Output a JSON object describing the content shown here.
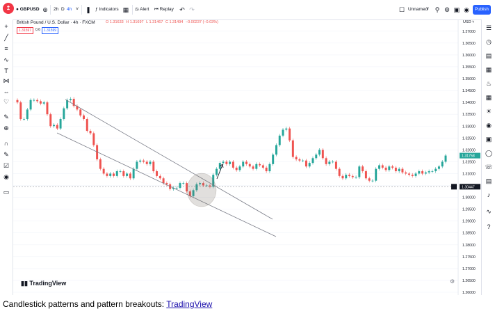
{
  "toolbar": {
    "symbol": "GBPUSD",
    "interval": "2h",
    "chart_type": "D",
    "timeframe": "4h",
    "indicators_label": "Indicators",
    "alert_label": "Alert",
    "replay_label": "Replay",
    "layout_name": "Unnamed",
    "publish_label": "Publish"
  },
  "legend": {
    "title": "British Pound / U.S. Dollar · 4h · FXCM",
    "open": "O 1.31633",
    "high": "H 1.31697",
    "low": "L 1.31467",
    "close": "C 1.31494",
    "change": "−0.00237 (−0.03%)",
    "sell_price": "1.31597",
    "spread": "0.6",
    "buy_price": "1.31599"
  },
  "price_axis": {
    "currency": "USD",
    "ticks": [
      "1.37000",
      "1.36500",
      "1.36000",
      "1.35500",
      "1.35000",
      "1.34500",
      "1.34000",
      "1.33500",
      "1.33000",
      "1.32500",
      "1.32000",
      "1.31500",
      "1.31000",
      "1.30500",
      "1.30000",
      "1.29500",
      "1.29000",
      "1.28500",
      "1.28000",
      "1.27500",
      "1.27000",
      "1.26500",
      "1.26000"
    ],
    "current_price": "1.31758",
    "crosshair_price": "1.30447"
  },
  "watermark": "TradingView",
  "caption": {
    "text": "Candlestick patterns and pattern breakouts: ",
    "link": "TradingView"
  },
  "colors": {
    "up": "#26a69a",
    "down": "#ef5350",
    "accent": "#2962ff",
    "trendline": "#787b86"
  },
  "icons": {
    "left": [
      "crosshair-icon",
      "trendline-icon",
      "fib-icon",
      "pattern-icon",
      "text-icon",
      "measure-icon",
      "forecast-icon",
      "heart-icon",
      "ruler-icon",
      "zoom-icon",
      "magnet-icon",
      "lock-drawings-icon",
      "lock-icon",
      "eye-icon",
      "trash-icon"
    ],
    "right": [
      "watchlist-icon",
      "alerts-icon",
      "news-icon",
      "data-window-icon",
      "hotlist-icon",
      "calendar-icon",
      "ideas-icon",
      "streams-icon",
      "chat-icon",
      "notifications-icon",
      "help-icon"
    ]
  },
  "chart_data": {
    "type": "candlestick",
    "series_name": "GBPUSD 4h",
    "ylim": [
      1.26,
      1.372
    ],
    "grid": true,
    "close": [
      1.34,
      1.333,
      1.333,
      1.337,
      1.341,
      1.341,
      1.3405,
      1.3395,
      1.34,
      1.335,
      1.33,
      1.3305,
      1.329,
      1.333,
      1.3375,
      1.341,
      1.3415,
      1.3385,
      1.337,
      1.3345,
      1.333,
      1.328,
      1.327,
      1.322,
      1.316,
      1.312,
      1.31,
      1.309,
      1.31,
      1.309,
      1.311,
      1.311,
      1.309,
      1.31,
      1.308,
      1.312,
      1.315,
      1.3155,
      1.315,
      1.314,
      1.315,
      1.311,
      1.309,
      1.308,
      1.306,
      1.3055,
      1.3035,
      1.304,
      1.304,
      1.306,
      1.306,
      1.3025,
      1.3005,
      1.303,
      1.3055,
      1.306,
      1.305,
      1.305,
      1.3045,
      1.3095,
      1.312,
      1.3145,
      1.315,
      1.314,
      1.315,
      1.3125,
      1.3115,
      1.313,
      1.315,
      1.314,
      1.313,
      1.312,
      1.314,
      1.3135,
      1.3125,
      1.311,
      1.314,
      1.318,
      1.322,
      1.326,
      1.3285,
      1.329,
      1.324,
      1.317,
      1.316,
      1.3155,
      1.3155,
      1.313,
      1.3145,
      1.3165,
      1.318,
      1.32,
      1.3165,
      1.314,
      1.315,
      1.315,
      1.312,
      1.309,
      1.308,
      1.3095,
      1.309,
      1.3085,
      1.3085,
      1.313,
      1.311,
      1.308,
      1.307,
      1.307,
      1.312,
      1.3135,
      1.3125,
      1.3115,
      1.313,
      1.3125,
      1.311,
      1.312,
      1.3105,
      1.31,
      1.3095,
      1.309,
      1.31,
      1.311,
      1.31,
      1.3105,
      1.311,
      1.311,
      1.312,
      1.313,
      1.315,
      1.3176
    ]
  }
}
